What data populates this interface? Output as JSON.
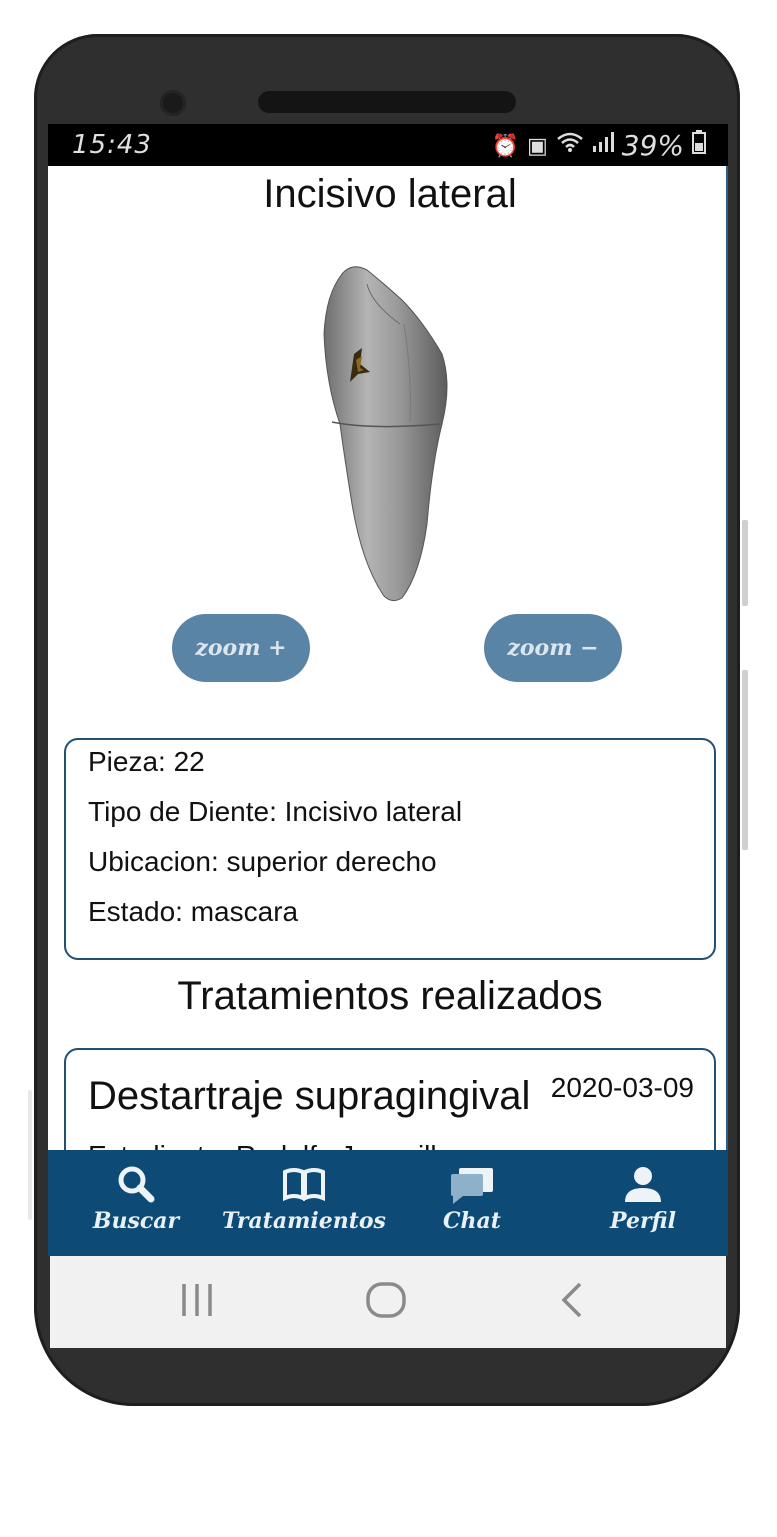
{
  "status": {
    "time": "15:43",
    "battery": "39%",
    "icons": [
      "alarm-icon",
      "photo-icon",
      "wifi-icon",
      "signal-icon",
      "battery-icon"
    ]
  },
  "page": {
    "title": "Incisivo lateral"
  },
  "zoom": {
    "in_label": "zoom +",
    "out_label": "zoom −"
  },
  "info": {
    "pieza": "Pieza: 22",
    "tipo": "Tipo de Diente: Incisivo lateral",
    "ubicacion": "Ubicacion: superior derecho",
    "estado": "Estado: mascara"
  },
  "treatments": {
    "title": "Tratamientos realizados",
    "items": [
      {
        "name": "Destartraje supragingival",
        "date": "2020-03-09",
        "student": "Estudiante: Rodolfo Jaramillo"
      }
    ]
  },
  "nav": {
    "items": [
      {
        "label": "Buscar",
        "icon": "search-icon"
      },
      {
        "label": "Tratamientos",
        "icon": "book-icon"
      },
      {
        "label": "Chat",
        "icon": "chat-icon"
      },
      {
        "label": "Perfil",
        "icon": "person-icon"
      }
    ]
  },
  "colors": {
    "nav_bg": "#0d4a75",
    "zoom_btn": "#5a84a6",
    "card_border": "#234f73"
  }
}
